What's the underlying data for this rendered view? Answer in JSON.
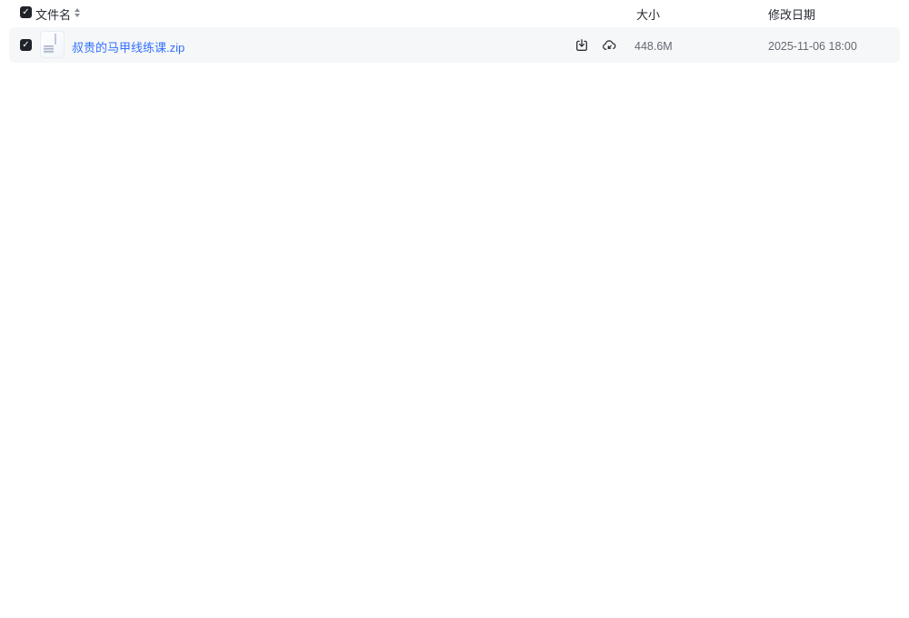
{
  "colors": {
    "link_blue": "#3370ff",
    "row_background": "#f6f7f8",
    "checkbox_fill": "#1f2329",
    "header_text": "#272b33",
    "secondary_text": "#646a73"
  },
  "table": {
    "select_all": {
      "checked": true,
      "icon": "check-icon"
    },
    "columns": [
      {
        "label": "文件名",
        "sortable": true,
        "sort_icon": "sort-carets-icon"
      },
      {
        "label": "大小"
      },
      {
        "label": "修改日期"
      }
    ],
    "rows": [
      {
        "selected": true,
        "file_icon": "zip-file-icon",
        "name": "叔贵的马甲线练课.zip",
        "size": "448.6M",
        "modified": "2025-11-06 18:00",
        "actions": [
          {
            "icon": "download-icon"
          },
          {
            "icon": "cloud-save-icon"
          }
        ]
      }
    ]
  }
}
